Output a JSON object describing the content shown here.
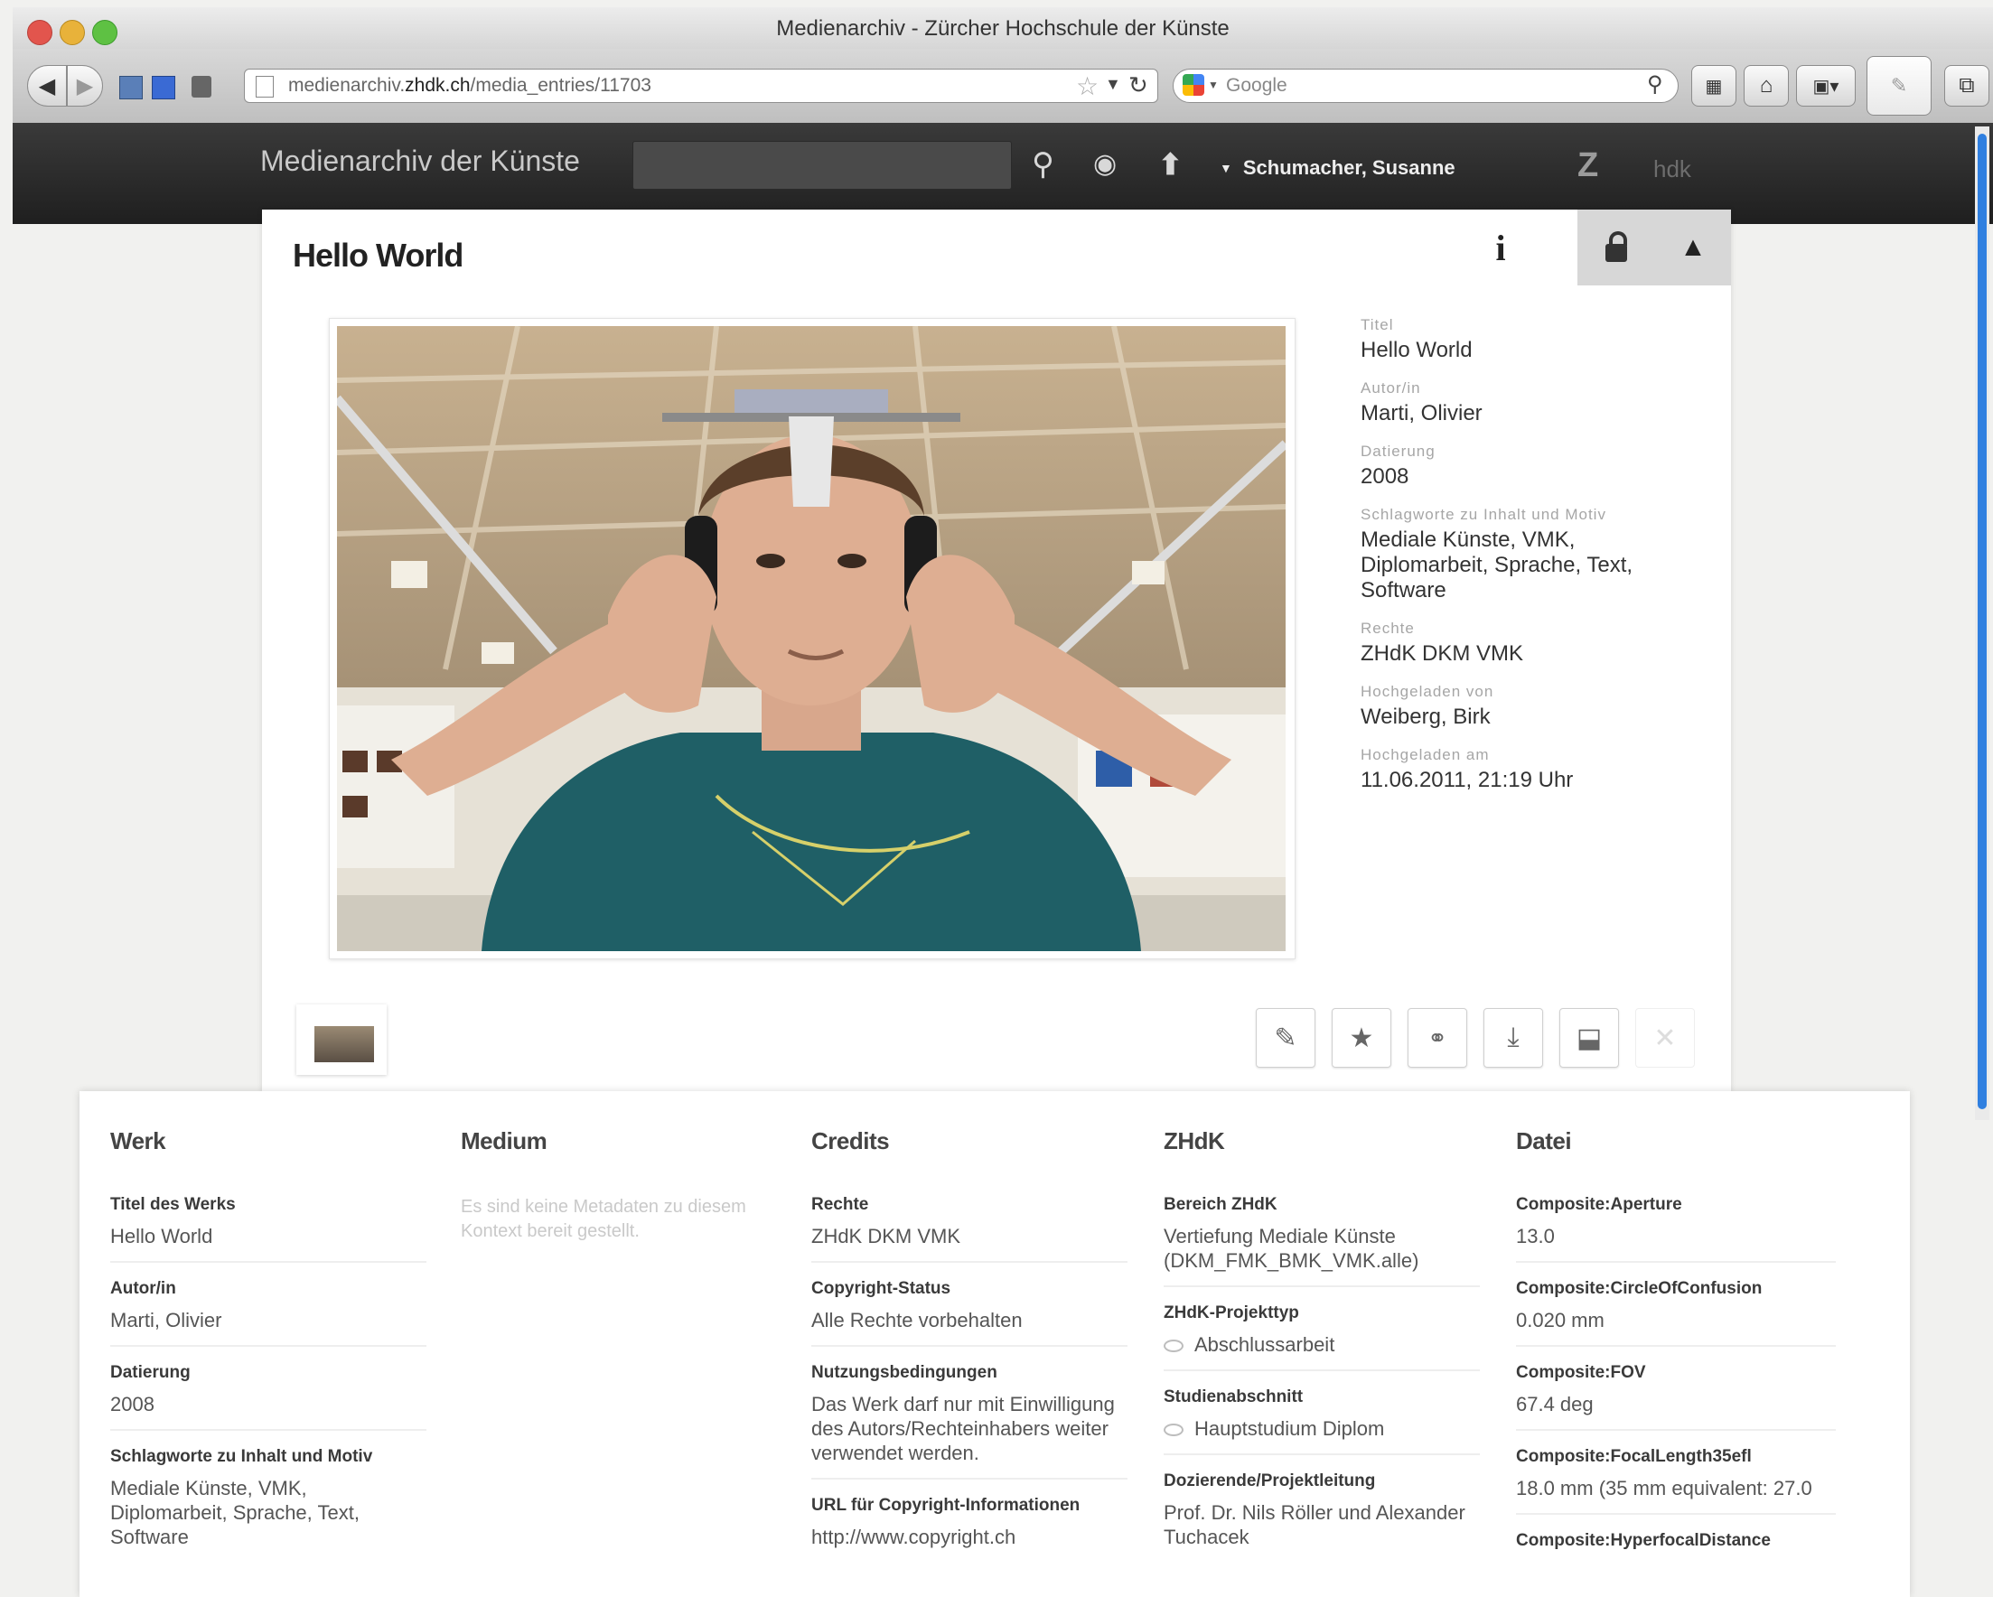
{
  "window": {
    "title": "Medienarchiv - Zürcher Hochschule der Künste"
  },
  "browser": {
    "url_prefix": "medienarchiv.",
    "url_domain": "zhdk.ch",
    "url_path": "/media_entries/11703",
    "search_placeholder": "Google"
  },
  "app": {
    "brand": "Medienarchiv der Künste",
    "user": "Schumacher, Susanne",
    "logo": "Z",
    "logo_sub": "hdk"
  },
  "entry": {
    "title": "Hello World",
    "meta": [
      {
        "label": "Titel",
        "value": "Hello World"
      },
      {
        "label": "Autor/in",
        "value": "Marti, Olivier"
      },
      {
        "label": "Datierung",
        "value": "2008"
      },
      {
        "label": "Schlagworte zu Inhalt und Motiv",
        "value": "Mediale Künste, VMK, Diplomarbeit, Sprache, Text, Software"
      },
      {
        "label": "Rechte",
        "value": "ZHdK DKM VMK"
      },
      {
        "label": "Hochgeladen von",
        "value": "Weiberg, Birk"
      },
      {
        "label": "Hochgeladen am",
        "value": "11.06.2011, 21:19 Uhr"
      }
    ]
  },
  "details": {
    "werk": {
      "heading": "Werk",
      "fields": [
        {
          "label": "Titel des Werks",
          "value": "Hello World"
        },
        {
          "label": "Autor/in",
          "value": "Marti, Olivier"
        },
        {
          "label": "Datierung",
          "value": "2008"
        },
        {
          "label": "Schlagworte zu Inhalt und Motiv",
          "value": "Mediale Künste, VMK, Diplomarbeit, Sprache, Text, Software"
        }
      ]
    },
    "medium": {
      "heading": "Medium",
      "note": "Es sind keine Metadaten zu diesem Kontext bereit gestellt."
    },
    "credits": {
      "heading": "Credits",
      "fields": [
        {
          "label": "Rechte",
          "value": "ZHdK DKM VMK"
        },
        {
          "label": "Copyright-Status",
          "value": "Alle Rechte vorbehalten"
        },
        {
          "label": "Nutzungsbedingungen",
          "value": "Das Werk darf nur mit Einwilligung des Autors/Rechteinhabers weiter verwendet werden."
        },
        {
          "label": "URL für Copyright-Informationen",
          "value": "http://www.copyright.ch"
        }
      ]
    },
    "zhdk": {
      "heading": "ZHdK",
      "fields": [
        {
          "label": "Bereich ZHdK",
          "value": "Vertiefung Mediale Künste (DKM_FMK_BMK_VMK.alle)"
        },
        {
          "label": "ZHdK-Projekttyp",
          "value": "Abschlussarbeit"
        },
        {
          "label": "Studienabschnitt",
          "value": "Hauptstudium Diplom"
        },
        {
          "label": "Dozierende/Projektleitung",
          "value": "Prof. Dr. Nils Röller und Alexander Tuchacek"
        }
      ]
    },
    "datei": {
      "heading": "Datei",
      "fields": [
        {
          "label": "Composite:Aperture",
          "value": "13.0"
        },
        {
          "label": "Composite:CircleOfConfusion",
          "value": "0.020 mm"
        },
        {
          "label": "Composite:FOV",
          "value": "67.4 deg"
        },
        {
          "label": "Composite:FocalLength35efl",
          "value": "18.0 mm (35 mm equivalent: 27.0"
        },
        {
          "label": "Composite:HyperfocalDistance",
          "value": ""
        }
      ]
    }
  }
}
